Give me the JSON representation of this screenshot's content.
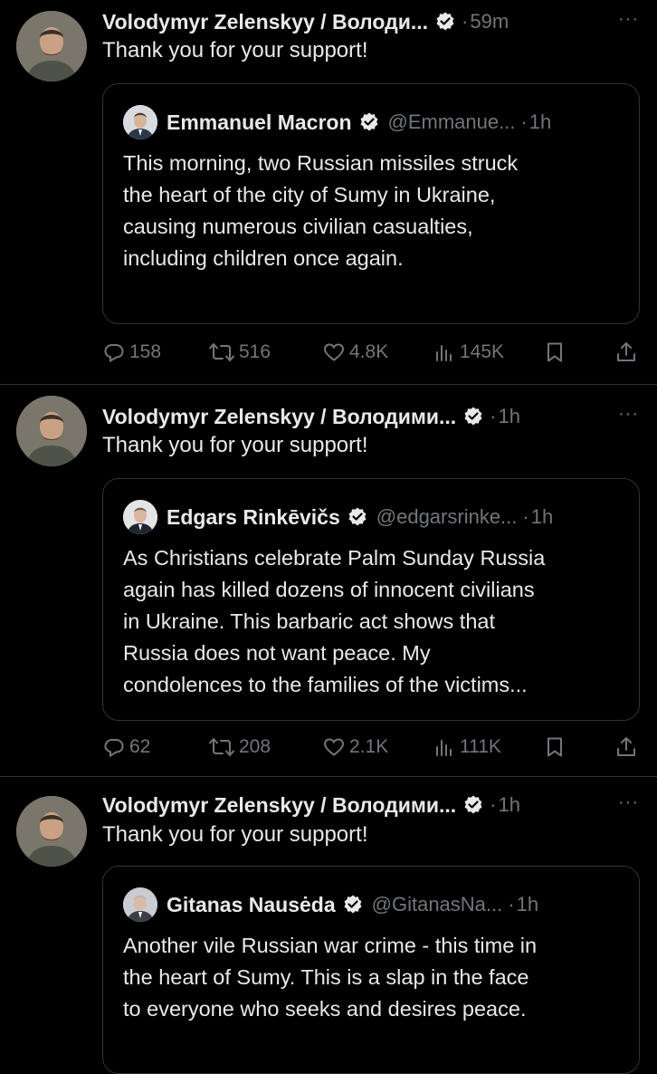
{
  "posts": [
    {
      "author": "Volodymyr Zelenskyy / Володи...",
      "time": "59m",
      "text": "Thank you for your support!",
      "quote": {
        "author": "Emmanuel Macron",
        "handle": "@Emmanue...",
        "time": "1h",
        "lines": [
          "This morning, two Russian missiles struck",
          "the heart of the city of Sumy in Ukraine,",
          "causing numerous civilian casualties,",
          "including children once again."
        ]
      },
      "stats": {
        "replies": "158",
        "reposts": "516",
        "likes": "4.8K",
        "views": "145K"
      }
    },
    {
      "author": "Volodymyr Zelenskyy / Володими...",
      "time": "1h",
      "text": "Thank you for your support!",
      "quote": {
        "author": "Edgars Rinkēvičs",
        "handle": "@edgarsrinke...",
        "time": "1h",
        "lines": [
          "As Christians celebrate Palm Sunday Russia",
          "again has killed dozens of innocent civilians",
          "in Ukraine. This barbaric act shows that",
          "Russia does not want peace. My",
          "condolences to the families of the victims..."
        ]
      },
      "stats": {
        "replies": "62",
        "reposts": "208",
        "likes": "2.1K",
        "views": "111K"
      }
    },
    {
      "author": "Volodymyr Zelenskyy / Володими...",
      "time": "1h",
      "text": "Thank you for your support!",
      "quote": {
        "author": "Gitanas Nausėda",
        "handle": "@GitanasNa...",
        "time": "1h",
        "lines": [
          "Another vile Russian war crime - this time in",
          "the heart of Sumy. This is a slap in the face",
          "to everyone who seeks and desires peace."
        ]
      }
    }
  ],
  "ui": {
    "dot": "·",
    "more": "···"
  },
  "colors": {
    "background": "#000000",
    "text": "#e7e9ea",
    "muted": "#71767b",
    "border": "#2f3336",
    "verified": "#1d9bf0"
  },
  "icons": [
    "reply-icon",
    "repost-icon",
    "like-icon",
    "views-icon",
    "bookmark-icon",
    "share-icon",
    "verified-badge-icon"
  ]
}
